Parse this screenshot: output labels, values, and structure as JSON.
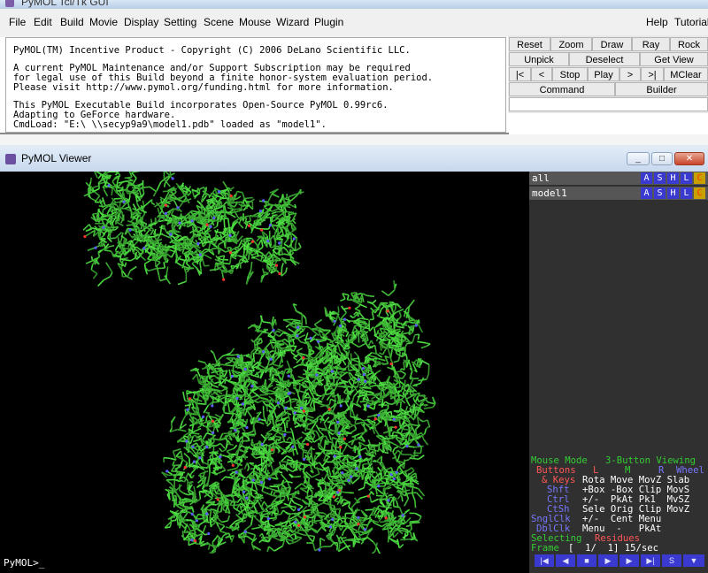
{
  "window": {
    "title": "PyMOL Tcl/Tk GUI"
  },
  "menu": [
    "File",
    "Edit",
    "Build",
    "Movie",
    "Display",
    "Setting",
    "Scene",
    "Mouse",
    "Wizard",
    "Plugin"
  ],
  "menu_right": [
    "Help",
    "Tutorial"
  ],
  "console": {
    "lines": [
      "PyMOL(TM) Incentive Product - Copyright (C) 2006 DeLano Scientific LLC.",
      "A current PyMOL Maintenance and/or Support Subscription may be required",
      "for legal use of this Build beyond a finite honor-system evaluation period.",
      "Please visit http://www.pymol.org/funding.html for more information.",
      "This PyMOL Executable Build incorporates Open-Source PyMOL 0.99rc6.",
      "Adapting to GeForce hardware.",
      "CmdLoad: \"E:\\ \\\\secyp9a9\\model1.pdb\" loaded as \"model1\"."
    ]
  },
  "buttons": {
    "row1": [
      "Reset",
      "Zoom",
      "Draw",
      "Ray",
      "Rock"
    ],
    "row2": [
      "Unpick",
      "Deselect",
      "Get View"
    ],
    "row3": [
      "|<",
      "<",
      "Stop",
      "Play",
      ">",
      ">|",
      "MClear"
    ],
    "row4": [
      "Command",
      "Builder"
    ]
  },
  "viewer": {
    "title": "PyMOL Viewer",
    "controls": [
      "_",
      "□",
      "✕"
    ]
  },
  "objects": [
    {
      "name": "all",
      "buttons": [
        "A",
        "S",
        "H",
        "L",
        "C"
      ]
    },
    {
      "name": "model1",
      "buttons": [
        "A",
        "S",
        "H",
        "L",
        "C"
      ]
    }
  ],
  "mouse_panel": {
    "mode_label": "Mouse Mode",
    "mode_value": "3-Button Viewing",
    "header": {
      "buttons": "Buttons",
      "l": "L",
      "m": "M",
      "r": "R",
      "wheel": "Wheel"
    },
    "keys_label": "& Keys",
    "keys_values": "Rota Move MovZ Slab",
    "rows": [
      {
        "key": "Shft",
        "values": "+Box -Box Clip MovS"
      },
      {
        "key": "Ctrl",
        "values": "+/-  PkAt Pk1  MvSZ"
      },
      {
        "key": "CtSh",
        "values": "Sele Orig Clip MovZ"
      },
      {
        "key": "SnglClk",
        "values": "+/-  Cent Menu"
      },
      {
        "key": "DblClk",
        "values": "Menu  -   PkAt"
      }
    ],
    "selecting_label": "Selecting",
    "selecting_value": "Residues",
    "frame_label": "Frame",
    "frame_value": "[  1/  1] 15/sec"
  },
  "transport": [
    "|◀",
    "◀",
    "■",
    "▶",
    "▶",
    "▶|",
    "S",
    "▼"
  ],
  "prompt": "PyMOL>_",
  "colors": {
    "viewer_bg": "#000000",
    "panel_bg": "#303030",
    "object_btn": "#3a3ad0",
    "mouse_mode_green": "#33cc33",
    "key_blue": "#7777ff",
    "key_red": "#ff5555"
  }
}
